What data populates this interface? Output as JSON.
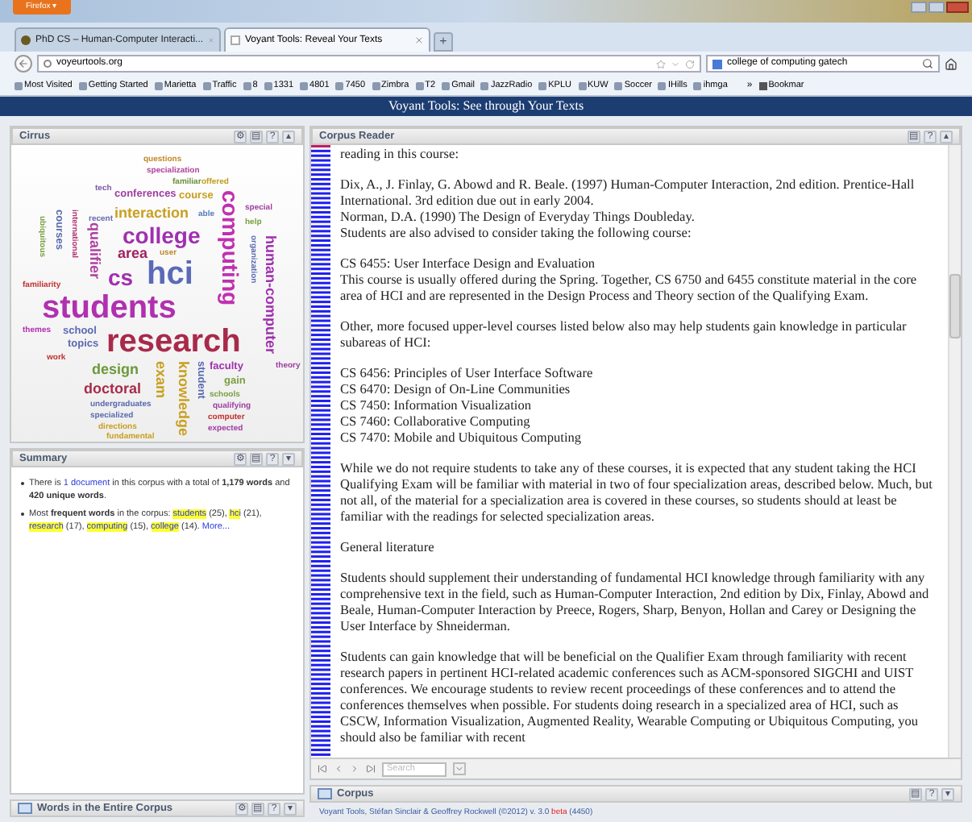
{
  "browser": {
    "menu_button": "Firefox ▾",
    "tabs": [
      {
        "label": "PhD CS – Human-Computer Interacti...",
        "selected": false
      },
      {
        "label": "Voyant Tools: Reveal Your Texts",
        "selected": true
      }
    ],
    "new_tab": "+",
    "address": "voyeurtools.org",
    "search": "college of computing gatech",
    "bookmarks": [
      "Most Visited",
      "Getting Started",
      "Marietta",
      "Traffic",
      "8",
      "1331",
      "4801",
      "7450",
      "Zimbra",
      "T2",
      "Gmail",
      "JazzRadio",
      "KPLU",
      "KUW",
      "Soccer",
      "IHills",
      "ihmga"
    ],
    "bookmarks_more": "»",
    "bookmarks_menu": "Bookmar"
  },
  "app_title": "Voyant Tools: See through Your Texts",
  "cirrus": {
    "title": "Cirrus",
    "tools": [
      "⚙",
      "▤",
      "?",
      "▴"
    ],
    "words": [
      {
        "text": "questions",
        "kind": "s",
        "color": "#c08a2a"
      },
      {
        "text": "specialization",
        "kind": "s",
        "color": "#b0439e"
      },
      {
        "text": "familiar",
        "kind": "s",
        "color": "#6b8f3a"
      },
      {
        "text": "offered",
        "kind": "s",
        "color": "#c0a020"
      },
      {
        "text": "tech",
        "kind": "s",
        "color": "#7a5aa8"
      },
      {
        "text": "conferences",
        "kind": "m",
        "color": "#a03fa0"
      },
      {
        "text": "course",
        "kind": "m",
        "color": "#c8a020"
      },
      {
        "text": "special",
        "kind": "s",
        "color": "#a03fa0"
      },
      {
        "text": "interaction",
        "kind": "l",
        "color": "#c8a020"
      },
      {
        "text": "computing",
        "kind": "xl-up",
        "color": "#c030b0"
      },
      {
        "text": "recent",
        "kind": "s",
        "color": "#6a6ab0"
      },
      {
        "text": "help",
        "kind": "s",
        "color": "#7aa040"
      },
      {
        "text": "college",
        "kind": "xl",
        "color": "#a030b0"
      },
      {
        "text": "organization",
        "kind": "s-up",
        "color": "#5a6ab0"
      },
      {
        "text": "qualifier",
        "kind": "l-up",
        "color": "#b040a0"
      },
      {
        "text": "area",
        "kind": "l",
        "color": "#a02060"
      },
      {
        "text": "user",
        "kind": "s",
        "color": "#c08a2a"
      },
      {
        "text": "cs",
        "kind": "xl",
        "color": "#a030b0"
      },
      {
        "text": "hci",
        "kind": "xxl",
        "color": "#5a6ab8"
      },
      {
        "text": "human-computer",
        "kind": "l-up",
        "color": "#a030b0"
      },
      {
        "text": "familiarity",
        "kind": "s",
        "color": "#c03030"
      },
      {
        "text": "students",
        "kind": "xxl",
        "color": "#b030b0"
      },
      {
        "text": "themes",
        "kind": "s",
        "color": "#b030b0"
      },
      {
        "text": "school",
        "kind": "m",
        "color": "#5a6ab0"
      },
      {
        "text": "topics",
        "kind": "m",
        "color": "#5a6ab0"
      },
      {
        "text": "research",
        "kind": "xxl",
        "color": "#a82a4a"
      },
      {
        "text": "theory",
        "kind": "s",
        "color": "#a03fa0"
      },
      {
        "text": "work",
        "kind": "s",
        "color": "#c03030"
      },
      {
        "text": "design",
        "kind": "l",
        "color": "#6b9a3a"
      },
      {
        "text": "exam",
        "kind": "l-up",
        "color": "#c8a020"
      },
      {
        "text": "knowledge",
        "kind": "l-up",
        "color": "#c8a020"
      },
      {
        "text": "faculty",
        "kind": "m",
        "color": "#a030b0"
      },
      {
        "text": "gain",
        "kind": "m",
        "color": "#7aa040"
      },
      {
        "text": "student",
        "kind": "m-up",
        "color": "#5a6ab0"
      },
      {
        "text": "doctoral",
        "kind": "l",
        "color": "#a82a4a"
      },
      {
        "text": "schools",
        "kind": "s",
        "color": "#7aa040"
      },
      {
        "text": "undergraduates",
        "kind": "s",
        "color": "#5a6ab0"
      },
      {
        "text": "qualifying",
        "kind": "s",
        "color": "#a03fa0"
      },
      {
        "text": "specialized",
        "kind": "s",
        "color": "#5a6ab0"
      },
      {
        "text": "computer",
        "kind": "s",
        "color": "#c03030"
      },
      {
        "text": "directions",
        "kind": "s",
        "color": "#c8a020"
      },
      {
        "text": "fundamental",
        "kind": "s",
        "color": "#c8a020"
      },
      {
        "text": "expected",
        "kind": "s",
        "color": "#a03fa0"
      },
      {
        "text": "able",
        "kind": "s",
        "color": "#5a7ab8"
      },
      {
        "text": "ubiquitous",
        "kind": "s-up",
        "color": "#7aa040"
      },
      {
        "text": "courses",
        "kind": "m-up",
        "color": "#5a6ab0"
      },
      {
        "text": "international",
        "kind": "s-up",
        "color": "#b03070"
      }
    ]
  },
  "summary": {
    "title": "Summary",
    "tools": [
      "⚙",
      "▤",
      "?",
      "▾"
    ],
    "items": [
      [
        {
          "kind": "text",
          "text": "There is "
        },
        {
          "kind": "link",
          "text": "1 document"
        },
        {
          "kind": "text",
          "text": " in this corpus with a total of **1,179 words** and **420 unique words**."
        }
      ],
      [
        {
          "kind": "text",
          "text": "Most **frequent words** in the corpus: "
        },
        {
          "kind": "highlight",
          "text": "students"
        },
        {
          "kind": "text",
          "text": " (25), "
        },
        {
          "kind": "highlight",
          "text": "hci"
        },
        {
          "kind": "text",
          "text": " (21), "
        },
        {
          "kind": "highlight",
          "text": "research"
        },
        {
          "kind": "text",
          "text": " (17), "
        },
        {
          "kind": "highlight",
          "text": "computing"
        },
        {
          "kind": "text",
          "text": " (15), "
        },
        {
          "kind": "highlight",
          "text": "college"
        },
        {
          "kind": "text",
          "text": " (14). "
        },
        {
          "kind": "link",
          "text": "More..."
        }
      ]
    ]
  },
  "words_panel": {
    "title": "Words in the Entire Corpus",
    "tools": [
      "⚙",
      "▤",
      "?",
      "▾"
    ]
  },
  "reader": {
    "title": "Corpus Reader",
    "tools": [
      "▤",
      "?",
      "▴"
    ],
    "blocks": [
      [
        "reading in this course:"
      ],
      [
        "Dix, A., J. Finlay, G. Abowd and R. Beale. (1997) Human-Computer Interaction, 2nd edition. Prentice-Hall International. 3rd edition due out in early 2004.",
        "Norman, D.A. (1990) The Design of Everyday Things Doubleday.",
        "Students are also advised to consider taking the following course:"
      ],
      [
        "CS 6455: User Interface Design and Evaluation",
        "This course is usually offered during the Spring. Together, CS 6750 and 6455 constitute material in the core area of HCI and are represented in the Design Process and Theory section of the Qualifying Exam."
      ],
      [
        "Other, more focused upper-level courses listed below also may help students gain knowledge in particular subareas of HCI:"
      ],
      [
        "CS 6456: Principles of User Interface Software",
        "CS 6470: Design of On-Line Communities",
        "CS 7450: Information Visualization",
        "CS 7460: Collaborative Computing",
        "CS 7470: Mobile and Ubiquitous Computing"
      ],
      [
        "While we do not require students to take any of these courses, it is expected that any student taking the HCI Qualifying Exam will be familiar with material in two of four specialization areas, described below. Much, but not all, of the material for a specialization area is covered in these courses, so students should at least be familiar with the readings for selected specialization areas."
      ],
      [
        "General literature"
      ],
      [
        "Students should supplement their understanding of fundamental HCI knowledge through familiarity with any comprehensive text in the field, such as Human-Computer Interaction, 2nd edition by Dix, Finlay, Abowd and Beale, Human-Computer Interaction by Preece, Rogers, Sharp, Benyon, Hollan and Carey or Designing the User Interface by Shneiderman."
      ],
      [
        "Students can gain knowledge that will be beneficial on the Qualifier Exam through familiarity with recent research papers in pertinent HCI-related academic conferences such as ACM-sponsored SIGCHI and UIST conferences. We encourage students to review recent proceedings of these conferences and to attend the conferences themselves when possible. For students doing research in a specialized area of HCI, such as CSCW, Information Visualization, Augmented Reality, Wearable Computing or Ubiquitous Computing, you should also be familiar with recent"
      ]
    ],
    "search_placeholder": "Search"
  },
  "corpus_panel": {
    "title": "Corpus",
    "tools": [
      "▤",
      "?",
      "▾"
    ]
  },
  "footer": {
    "text": "Voyant Tools, Stéfan Sinclair & Geoffrey Rockwell (©2012) v. 3.0 ",
    "beta": "beta",
    "build": " (4450)"
  }
}
